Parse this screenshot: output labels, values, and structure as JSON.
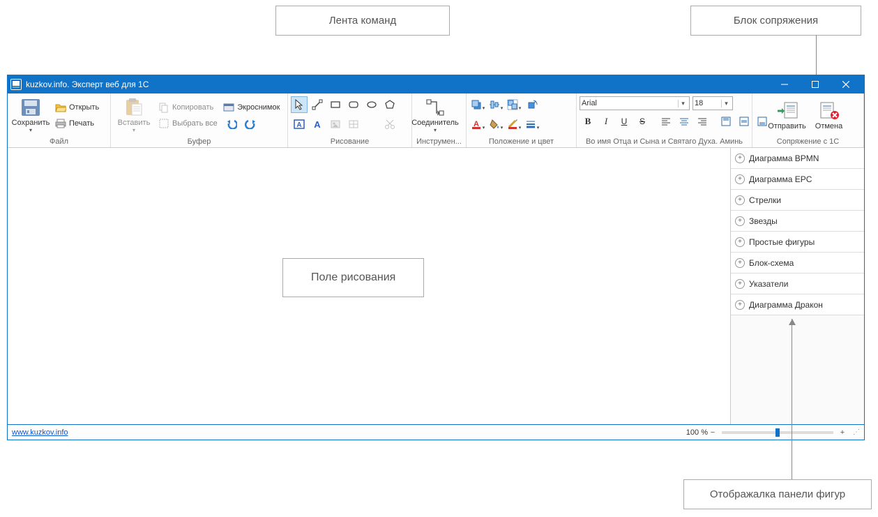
{
  "callouts": {
    "ribbon": "Лента команд",
    "integration": "Блок сопряжения",
    "drawing_field": "Поле рисования",
    "shapes_panel": "Отображалка панели фигур"
  },
  "window": {
    "title": "kuzkov.info. Эксперт веб для 1С"
  },
  "ribbon": {
    "groups": {
      "file": {
        "label": "Файл",
        "save": "Сохранить",
        "open": "Открыть",
        "print": "Печать"
      },
      "buffer": {
        "label": "Буфер",
        "paste": "Вставить",
        "copy": "Копировать",
        "select_all": "Выбрать все",
        "screenshot": "Экроснимок"
      },
      "drawing": {
        "label": "Рисование"
      },
      "tools": {
        "label": "Инструмен...",
        "connector": "Соединитель"
      },
      "position_color": {
        "label": "Положение и цвет"
      },
      "font_group": {
        "label": "Во имя Отца и Сына и Святаго Духа. Аминь",
        "font_name": "Arial",
        "font_size": "18"
      },
      "integration": {
        "label": "Сопряжение с 1С",
        "send": "Отправить",
        "cancel": "Отмена"
      }
    }
  },
  "shapes_panel": {
    "items": [
      "Диаграмма BPMN",
      "Диаграмма EPC",
      "Стрелки",
      "Звезды",
      "Простые фигуры",
      "Блок-схема",
      "Указатели",
      "Диаграмма Дракон"
    ]
  },
  "status_bar": {
    "link": "www.kuzkov.info",
    "zoom": "100 %",
    "zoom_value": 50
  }
}
